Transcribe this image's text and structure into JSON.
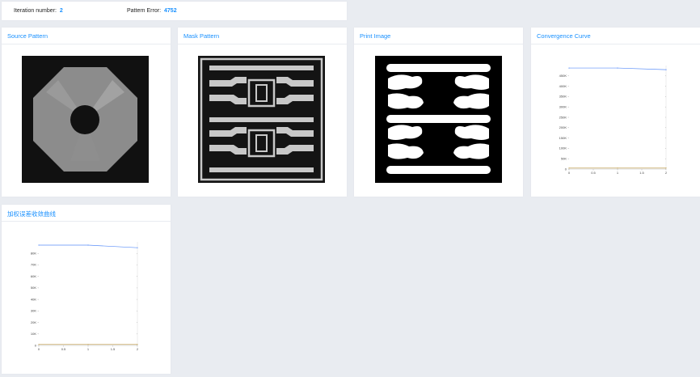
{
  "status": {
    "iteration_label": "Iteration number:",
    "iteration_value": "2",
    "error_label": "Pattern Error:",
    "error_value": "4752"
  },
  "panels": {
    "source": {
      "title": "Source Pattern"
    },
    "mask": {
      "title": "Mask Pattern"
    },
    "print": {
      "title": "Print Image"
    },
    "convergence": {
      "title": "Convergence Curve"
    },
    "weighted": {
      "title": "加权误差收敛曲线"
    }
  },
  "colors": {
    "accent": "#1890ff",
    "series_blue": "#5b8ff9",
    "series_orange": "#c4a35a"
  },
  "chart_data": [
    {
      "type": "line",
      "title": "Convergence Curve",
      "x_ticks": [
        "0",
        "0.5",
        "1",
        "1.5",
        "2"
      ],
      "y_ticks": [
        "0",
        "50K",
        "100K",
        "150K",
        "200K",
        "250K",
        "300K",
        "350K",
        "400K",
        "450K"
      ],
      "xlim": [
        0,
        2
      ],
      "ylim": [
        0,
        500000
      ],
      "series": [
        {
          "x": [
            0,
            1,
            2
          ],
          "values": [
            488000,
            488000,
            480000
          ]
        },
        {
          "x": [
            0,
            1,
            2
          ],
          "values": [
            4800,
            4760,
            4752
          ]
        }
      ]
    },
    {
      "type": "line",
      "title": "加权误差收敛曲线",
      "x_ticks": [
        "0",
        "0.5",
        "1",
        "1.5",
        "2"
      ],
      "y_ticks": [
        "0",
        "10K",
        "20K",
        "30K",
        "40K",
        "50K",
        "60K",
        "70K",
        "80K"
      ],
      "xlim": [
        0,
        2
      ],
      "ylim": [
        0,
        80000
      ],
      "series": [
        {
          "x": [
            0,
            1,
            2
          ],
          "values": [
            77500,
            77500,
            75500
          ]
        },
        {
          "x": [
            0,
            1,
            2
          ],
          "values": [
            800,
            780,
            760
          ]
        }
      ]
    }
  ]
}
